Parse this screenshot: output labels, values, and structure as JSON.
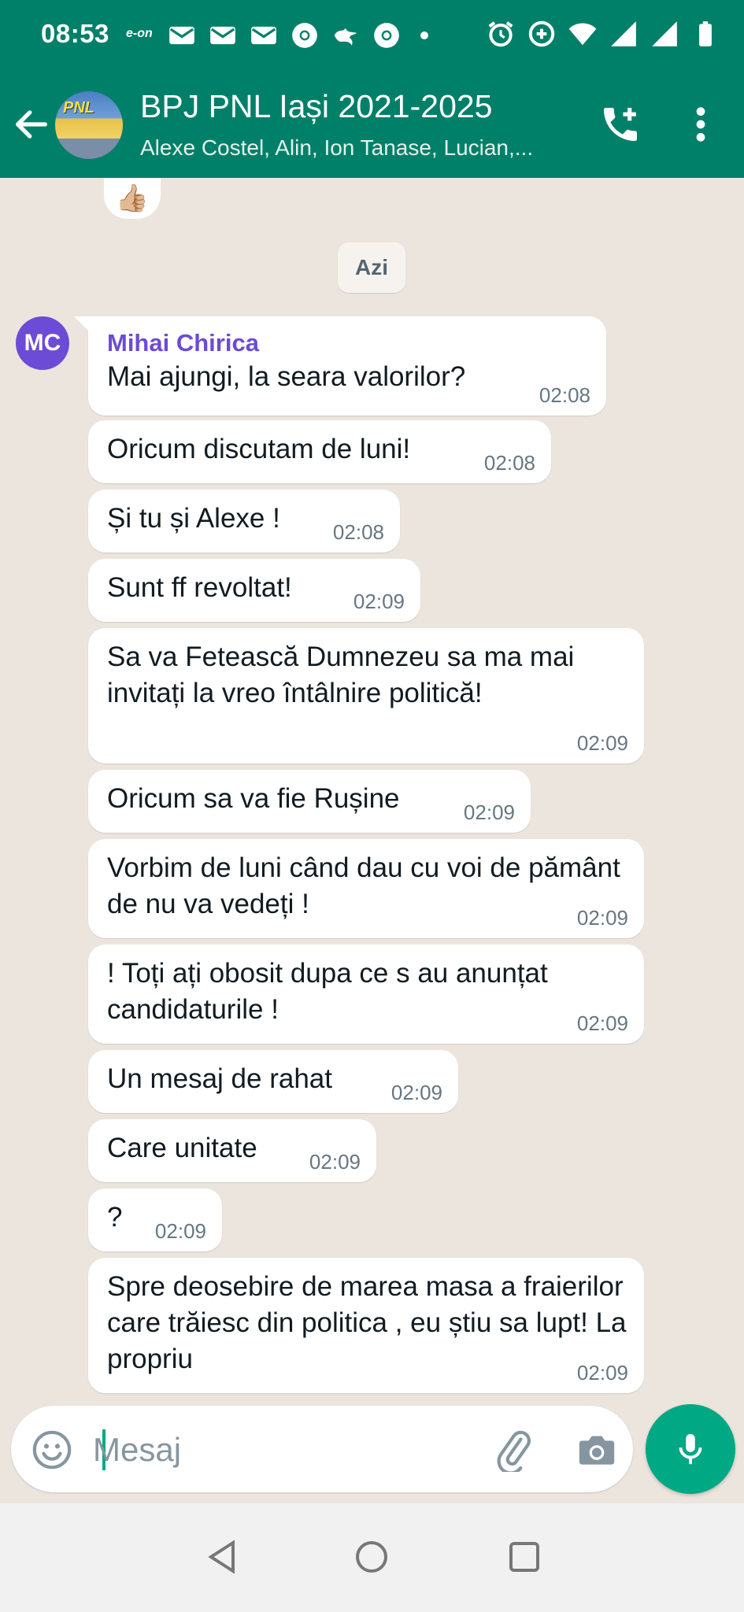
{
  "status_bar": {
    "time": "08:53",
    "carrier": "e-on",
    "icons_left": [
      "mail-icon",
      "mail-icon",
      "mail-icon",
      "chrome-icon",
      "dragon-icon",
      "chrome-icon",
      "dot-icon"
    ],
    "icons_right": [
      "alarm-icon",
      "data-saver-icon",
      "wifi-icon",
      "signal-icon",
      "signal-icon",
      "battery-icon"
    ]
  },
  "header": {
    "title": "BPJ PNL Iași 2021-2025",
    "members": "Alexe Costel, Alin, Ion Tanase, Lucian,...",
    "avatar_logo": "PNL",
    "back_icon": "arrow-left-icon",
    "call_icon": "phone-add-icon",
    "menu_icon": "more-vertical-icon"
  },
  "chat": {
    "reaction": "👍🏼",
    "date_label": "Azi",
    "sender": {
      "name": "Mihai Chirica",
      "initials": "MC",
      "color": "#6c4bd6"
    },
    "messages": [
      {
        "text": "Mai ajungi, la seara valorilor?",
        "time": "02:08"
      },
      {
        "text": "Oricum discutam de luni!",
        "time": "02:08"
      },
      {
        "text": "Și tu și Alexe !",
        "time": "02:08"
      },
      {
        "text": "Sunt ff revoltat!",
        "time": "02:09"
      },
      {
        "text": "Sa va Fetească Dumnezeu sa ma mai invitați la vreo întâlnire politică!",
        "time": "02:09"
      },
      {
        "text": "Oricum sa va fie Rușine",
        "time": "02:09"
      },
      {
        "text": "Vorbim de luni când dau cu voi de pământ de nu va vedeți !",
        "time": "02:09"
      },
      {
        "text": "! Toți  ați obosit dupa ce s au anunțat candidaturile !",
        "time": "02:09"
      },
      {
        "text": "Un mesaj de rahat",
        "time": "02:09"
      },
      {
        "text": "Care unitate",
        "time": "02:09"
      },
      {
        "text": "?",
        "time": "02:09"
      },
      {
        "text": "Spre deosebire de marea masa a fraierilor care trăiesc din politica , eu știu sa lupt! La propriu",
        "time": "02:09"
      }
    ]
  },
  "composer": {
    "placeholder": "Mesaj",
    "value": "",
    "emoji_icon": "emoji-icon",
    "attach_icon": "paperclip-icon",
    "camera_icon": "camera-icon",
    "mic_icon": "microphone-icon"
  },
  "colors": {
    "header": "#008069",
    "accent": "#00a884",
    "chat_background": "#ece5dd",
    "bubble": "#ffffff"
  }
}
